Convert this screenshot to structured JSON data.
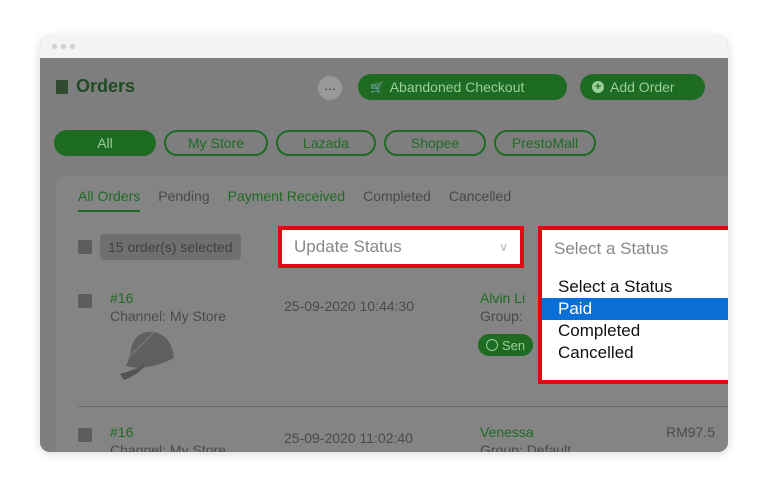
{
  "titlebar": {},
  "header": {
    "title": "Orders",
    "more_label": "…",
    "abandoned_checkout_label": "Abandoned Checkout",
    "add_order_label": "Add Order"
  },
  "channels": [
    "All",
    "My Store",
    "Lazada",
    "Shopee",
    "PrestoMall"
  ],
  "tabs": [
    "All Orders",
    "Pending",
    "Payment Received",
    "Completed",
    "Cancelled"
  ],
  "selection": {
    "count_label": "15 order(s) selected"
  },
  "update_status": {
    "placeholder": "Update Status"
  },
  "status_filter": {
    "placeholder": "Select a Status",
    "options": [
      "Select a Status",
      "Paid",
      "Completed",
      "Cancelled"
    ],
    "highlighted": "Paid"
  },
  "orders": [
    {
      "id": "#16",
      "channel": "Channel: My Store",
      "date": "25-09-2020 10:44:30",
      "customer": "Alvin Li",
      "group": "Group:",
      "send_label": "Sen",
      "amount": ""
    },
    {
      "id": "#16",
      "channel": "Channel: My Store",
      "date": "25-09-2020 11:02:40",
      "customer": "Venessa",
      "group": "Group: Default",
      "send_label": "",
      "amount": "RM97.5"
    }
  ],
  "colors": {
    "accent_green": "#1e6b23",
    "highlight_red": "#e30613",
    "select_blue": "#0a6fd6"
  }
}
